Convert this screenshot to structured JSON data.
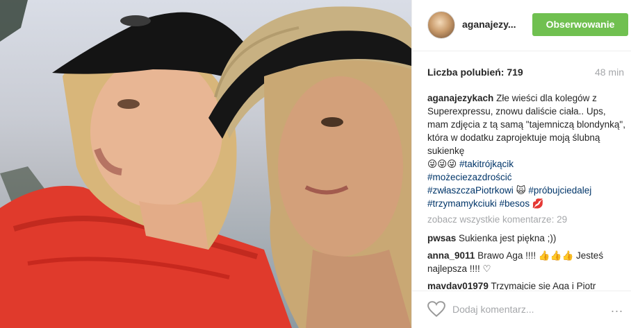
{
  "header": {
    "username": "aganajezy...",
    "follow_label": "Obserwowanie"
  },
  "meta": {
    "likes": "Liczba polubień: 719",
    "time": "48 min"
  },
  "caption": {
    "user": "aganajezykach",
    "text": "Złe wieści dla kolegów z Superexpressu, znowu daliście ciała.. Ups, mam zdjęcia z tą samą \"tajemniczą blondynką\", która w dodatku zaprojektuje moją ślubną sukienkę",
    "emoji": "😜😜😜",
    "tag1": "#takitrójkącik",
    "tag2": "#możeciezazdrościć",
    "tag3": "#zwłaszczaPiotrkowi",
    "emoji2": "🙀",
    "tag4": "#próbujciedalej",
    "tag5": "#trzymamykciuki",
    "tag6": "#besos",
    "emoji3": "💋"
  },
  "more_comments": "zobacz wszystkie komentarze: 29",
  "comments": [
    {
      "user": "pwsas",
      "text": "Sukienka jest piękna ;))"
    },
    {
      "user": "anna_9011",
      "text": "Brawo Aga !!!! 👍👍👍 Jesteś najlepsza !!!! ♡"
    },
    {
      "user": "mavdav01979",
      "text": "Trzymajcie się Aga i Piotr"
    }
  ],
  "footer": {
    "add_comment_placeholder": "Dodaj komentarz...",
    "more_icon": "..."
  }
}
